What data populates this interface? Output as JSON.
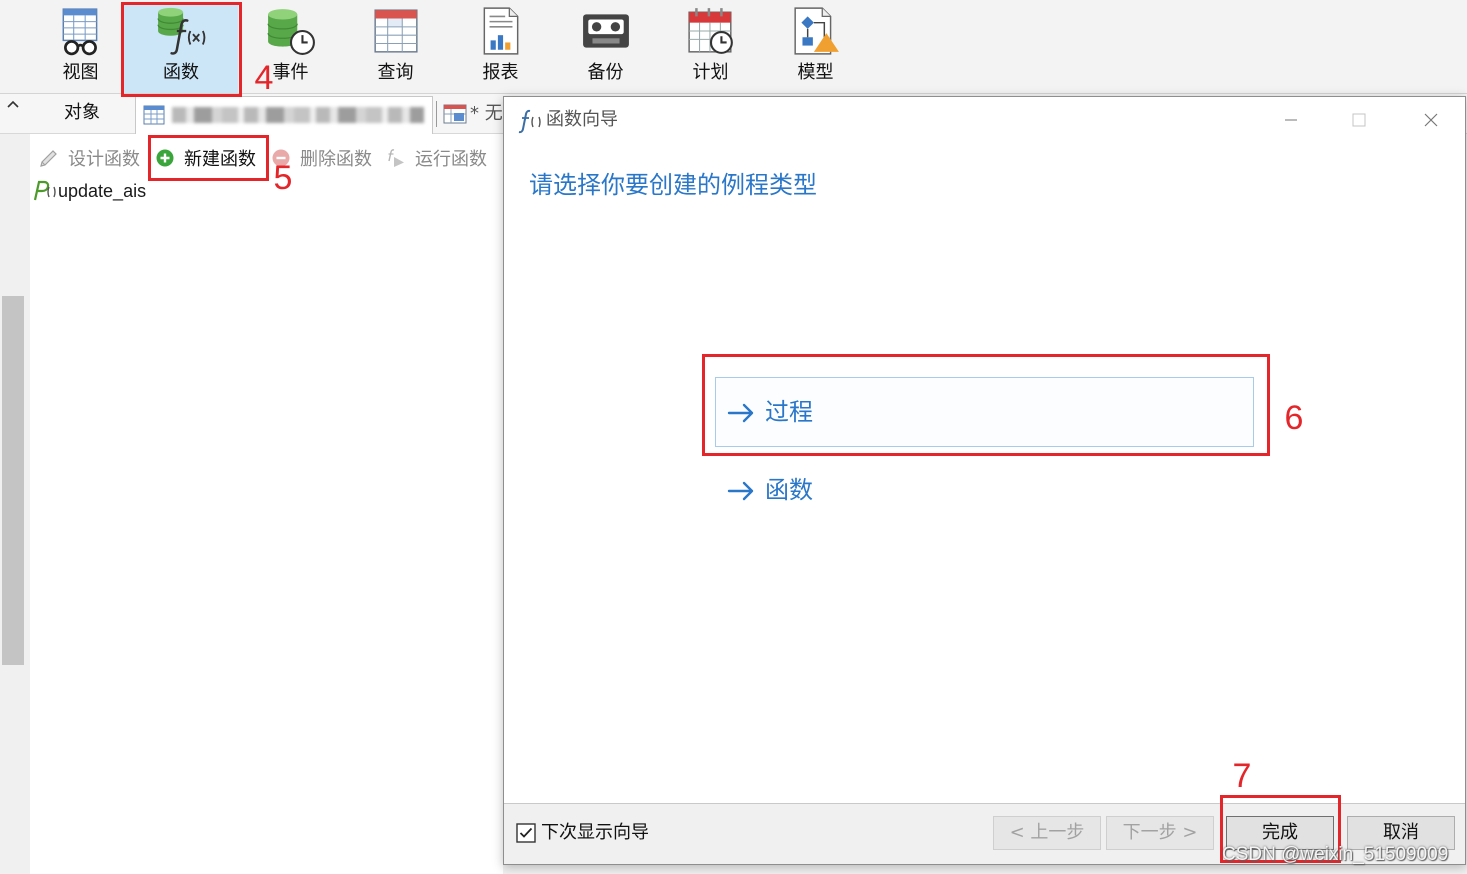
{
  "toolbar": {
    "items": [
      {
        "label": "视图",
        "icon": "view-icon",
        "selected": false
      },
      {
        "label": "函数",
        "icon": "function-icon",
        "selected": true
      },
      {
        "label": "事件",
        "icon": "event-icon",
        "selected": false
      },
      {
        "label": "查询",
        "icon": "query-icon",
        "selected": false
      },
      {
        "label": "报表",
        "icon": "report-icon",
        "selected": false
      },
      {
        "label": "备份",
        "icon": "backup-icon",
        "selected": false
      },
      {
        "label": "计划",
        "icon": "schedule-icon",
        "selected": false
      },
      {
        "label": "模型",
        "icon": "model-icon",
        "selected": false
      }
    ]
  },
  "tab_bar": {
    "objects_tab": "对象",
    "query_tab": "* 无"
  },
  "object_toolbar": [
    {
      "label": "设计函数",
      "icon": "pencil-icon",
      "enabled": false
    },
    {
      "label": "新建函数",
      "icon": "add-circle-icon",
      "enabled": true
    },
    {
      "label": "删除函数",
      "icon": "remove-circle-icon",
      "enabled": false
    },
    {
      "label": "运行函数",
      "icon": "run-function-icon",
      "enabled": false
    }
  ],
  "object_list": [
    {
      "name": "update_ais",
      "icon": "procedure-icon"
    }
  ],
  "wizard": {
    "title": "函数向导",
    "heading": "请选择你要创建的例程类型",
    "options": [
      {
        "label": "过程",
        "selected": true
      },
      {
        "label": "函数",
        "selected": false
      }
    ],
    "show_next_time": {
      "label": "下次显示向导",
      "checked": true
    },
    "buttons": {
      "previous": "< 上一步",
      "next": "下一步 >",
      "finish": "完成",
      "cancel": "取消"
    },
    "previous_enabled": false,
    "next_enabled": false
  },
  "annotations": {
    "step_function": "4",
    "step_new_function": "5",
    "step_procedure": "6",
    "step_finish": "7"
  },
  "watermark": "CSDN @weixin_51509009",
  "colors": {
    "accent": "#2a77c9",
    "annotation": "#e4262b",
    "selected_tool_bg": "#cde6f7",
    "new_function_icon": "#3aa53a"
  }
}
